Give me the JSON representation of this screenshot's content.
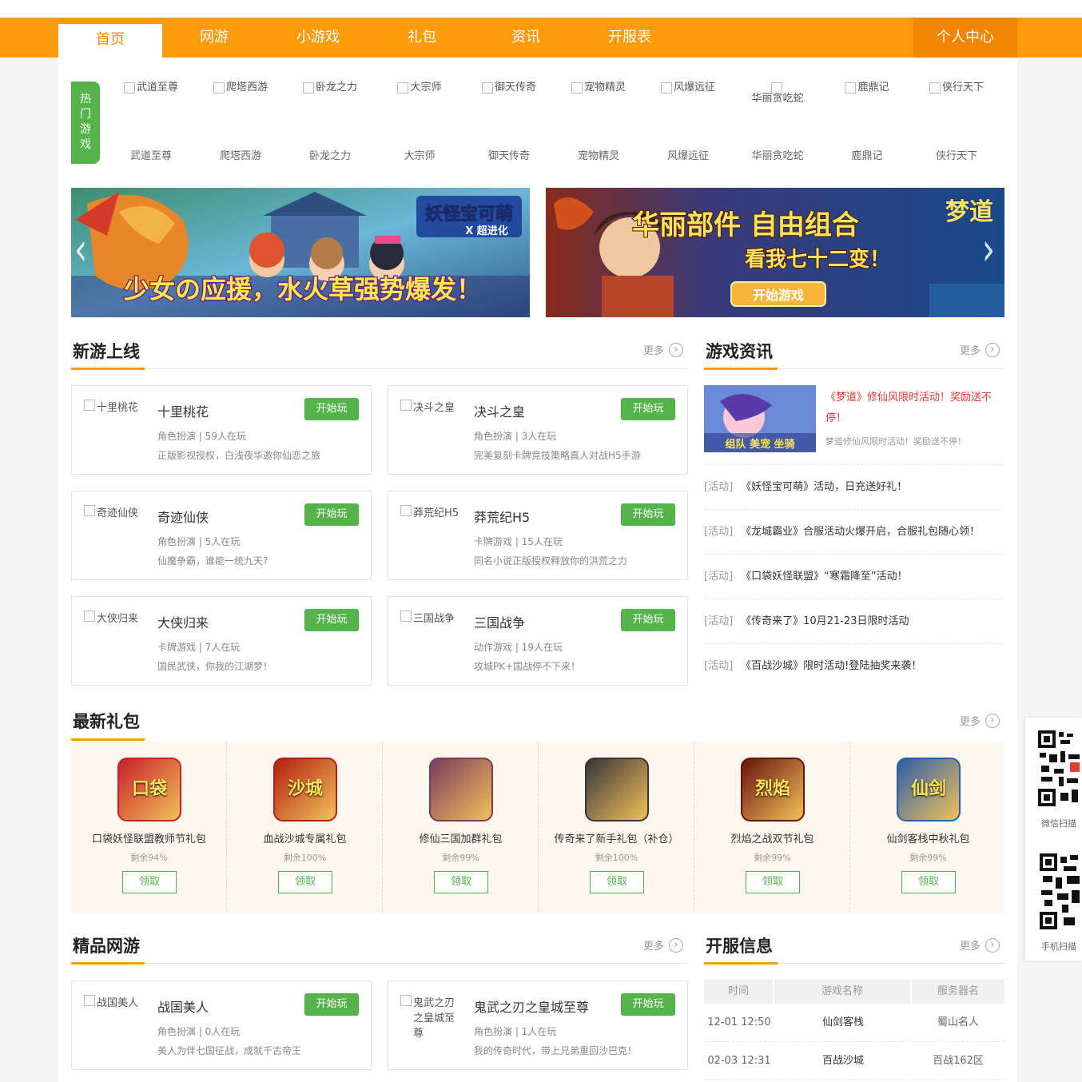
{
  "nav": {
    "items": [
      "首页",
      "网游",
      "小游戏",
      "礼包",
      "资讯",
      "开服表"
    ],
    "active_index": 0,
    "user_center": "个人中心"
  },
  "hot_games": {
    "tag": "热门游戏",
    "items": [
      {
        "alt": "武道至尊",
        "name": "武道至尊"
      },
      {
        "alt": "爬塔西游",
        "name": "爬塔西游"
      },
      {
        "alt": "卧龙之力",
        "name": "卧龙之力"
      },
      {
        "alt": "大宗师",
        "name": "大宗师"
      },
      {
        "alt": "御天传奇",
        "name": "御天传奇"
      },
      {
        "alt": "宠物精灵",
        "name": "宠物精灵"
      },
      {
        "alt": "风爆远征",
        "name": "风爆远征"
      },
      {
        "alt": "华丽贪吃蛇",
        "name": "华丽贪吃蛇"
      },
      {
        "alt": "鹿鼎记",
        "name": "鹿鼎记"
      },
      {
        "alt": "侠行天下",
        "name": "侠行天下"
      }
    ]
  },
  "banners": {
    "left": {
      "logo_line1": "妖怪宝可萌",
      "logo_line2": "X 超进化",
      "slogan": "少女の应援，水火草强势爆发！"
    },
    "right": {
      "headline1": "华丽部件 自由组合",
      "headline2": "看我七十二变！",
      "button": "开始游戏",
      "logo": "梦道"
    }
  },
  "new_games": {
    "title": "新游上线",
    "more": "更多",
    "play_label": "开始玩",
    "cards": [
      {
        "alt": "十里桃花",
        "name": "十里桃花",
        "meta": "角色扮演 | 59人在玩",
        "desc": "正版影视授权，白浅夜华邀你仙恋之旅"
      },
      {
        "alt": "决斗之皇",
        "name": "决斗之皇",
        "meta": "角色扮演 | 3人在玩",
        "desc": "完美复刻卡牌竞技策略真人对战H5手游"
      },
      {
        "alt": "奇迹仙侠",
        "name": "奇迹仙侠",
        "meta": "角色扮演 | 5人在玩",
        "desc": "仙魔争霸，谁能一统九天?"
      },
      {
        "alt": "莽荒纪H5",
        "name": "莽荒纪H5",
        "meta": "卡牌游戏 | 15人在玩",
        "desc": "同名小说正版授权释放你的洪荒之力"
      },
      {
        "alt": "大侠归来",
        "name": "大侠归来",
        "meta": "卡牌游戏 | 7人在玩",
        "desc": "国民武侠，你我的江湖梦！"
      },
      {
        "alt": "三国战争",
        "name": "三国战争",
        "meta": "动作游戏 | 19人在玩",
        "desc": "攻城PK+国战停不下来！"
      }
    ]
  },
  "news": {
    "title": "游戏资讯",
    "more": "更多",
    "top": {
      "title": "《梦道》修仙风限时活动！奖励送不停！",
      "sub": "梦道修仙风限时活动！奖励送不停！",
      "img_badge": "组队 美宠 坐骑"
    },
    "rows": [
      {
        "tag": "[活动]",
        "text": "《妖怪宝可萌》活动，日充送好礼！"
      },
      {
        "tag": "[活动]",
        "text": "《龙城霸业》合服活动火爆开启，合服礼包随心领！"
      },
      {
        "tag": "[活动]",
        "text": "《口袋妖怪联盟》“寒霜降至”活动！"
      },
      {
        "tag": "[活动]",
        "text": "《传奇来了》10月21-23日限时活动"
      },
      {
        "tag": "[活动]",
        "text": "《百战沙城》限时活动!登陆抽奖来袭！"
      }
    ]
  },
  "gifts": {
    "title": "最新礼包",
    "more": "更多",
    "get_label": "领取",
    "items": [
      {
        "name": "口袋妖怪联盟教师节礼包",
        "left": "剩余94%",
        "icon_text": "口袋",
        "color": "#c8202a"
      },
      {
        "name": "血战沙城专属礼包",
        "left": "剩余100%",
        "icon_text": "沙城",
        "color": "#b21e12"
      },
      {
        "name": "修仙三国加群礼包",
        "left": "剩余99%",
        "icon_text": "",
        "color": "#7a3b5c"
      },
      {
        "name": "传奇来了新手礼包（补仓）",
        "left": "剩余100%",
        "icon_text": "",
        "color": "#37343a"
      },
      {
        "name": "烈焰之战双节礼包",
        "left": "剩余99%",
        "icon_text": "烈焰",
        "color": "#6a120c"
      },
      {
        "name": "仙剑客栈中秋礼包",
        "left": "剩余99%",
        "icon_text": "仙剑",
        "color": "#2a5fa8"
      }
    ]
  },
  "premium_games": {
    "title": "精品网游",
    "more": "更多",
    "play_label": "开始玩",
    "cards": [
      {
        "alt": "战国美人",
        "name": "战国美人",
        "meta": "角色扮演 | 0人在玩",
        "desc": "美人为伴七国征战，成就千古帝王"
      },
      {
        "alt": "鬼武之刃之皇城至尊",
        "name": "鬼武之刃之皇城至尊",
        "meta": "角色扮演 | 1人在玩",
        "desc": "我的传奇时代，带上兄弟重回沙巴克！"
      }
    ]
  },
  "servers": {
    "title": "开服信息",
    "more": "更多",
    "headers": [
      "时间",
      "游戏名称",
      "服务器名"
    ],
    "rows": [
      {
        "time": "12-01 12:50",
        "game": "仙剑客栈",
        "server": "蜀山名人"
      },
      {
        "time": "02-03 12:31",
        "game": "百战沙城",
        "server": "百战162区"
      }
    ]
  },
  "qr": {
    "wechat_label": "微信扫描",
    "mobile_label": "手机扫描"
  },
  "colors": {
    "accent": "#ff9a0a",
    "green": "#54b34a",
    "red_link": "#e8372f"
  }
}
